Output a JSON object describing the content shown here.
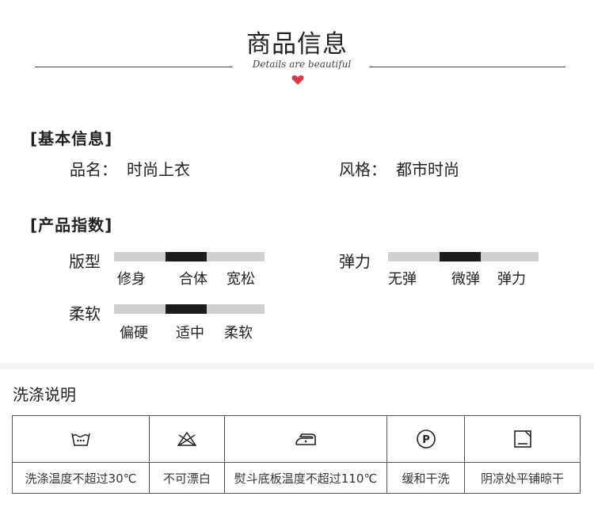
{
  "header": {
    "title": "商品信息",
    "subtitle": "Details are beautiful"
  },
  "basic_info": {
    "section_title": "[基本信息]",
    "name_label": "品名：",
    "name_value": "时尚上衣",
    "style_label": "风格：",
    "style_value": "都市时尚"
  },
  "indices": {
    "section_title": "[产品指数]",
    "fit": {
      "label": "版型",
      "selected_index": 1,
      "options": [
        "修身",
        "合体",
        "宽松"
      ]
    },
    "elasticity": {
      "label": "弹力",
      "selected_index": 1,
      "options": [
        "无弹",
        "微弹",
        "弹力"
      ]
    },
    "softness": {
      "label": "柔软",
      "selected_index": 1,
      "options": [
        "偏硬",
        "适中",
        "柔软"
      ]
    }
  },
  "washing": {
    "title": "洗涤说明",
    "items": [
      {
        "icon": "wash-30-icon",
        "text": "洗涤温度不超过30℃"
      },
      {
        "icon": "no-bleach-icon",
        "text": "不可漂白"
      },
      {
        "icon": "iron-icon",
        "text": "熨斗底板温度不超过110℃"
      },
      {
        "icon": "dry-clean-p-icon",
        "text": "缓和干洗"
      },
      {
        "icon": "flat-dry-shade-icon",
        "text": "阴凉处平铺晾干"
      }
    ]
  },
  "colors": {
    "bar_on": "#1c1c1c",
    "bar_off": "#cfcfcf",
    "heart": "#e0384b"
  }
}
